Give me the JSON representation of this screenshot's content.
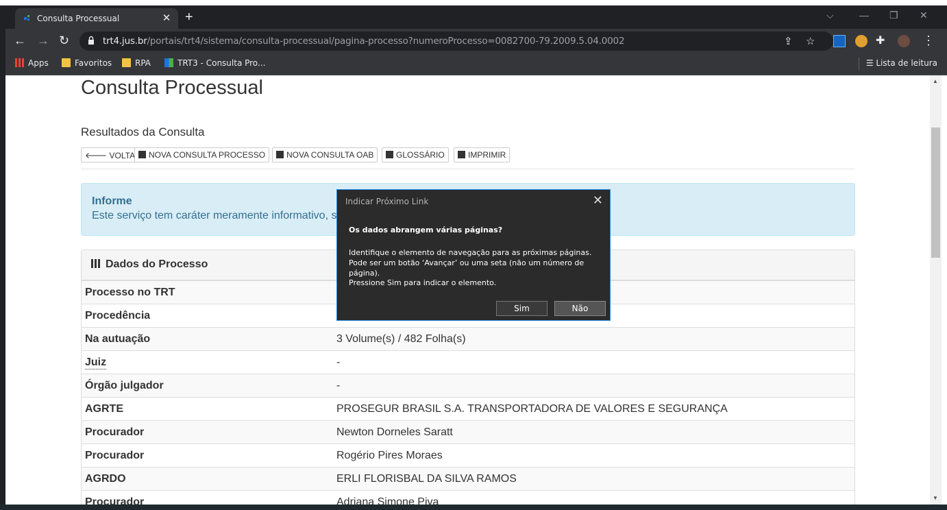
{
  "browser": {
    "tab_title": "Consulta Processual",
    "url_host": "trt4.jus.br",
    "url_path": "/portais/trt4/sistema/consulta-processual/pagina-processo?numeroProcesso=0082700-79.2009.5.04.0002",
    "bookmarks": [
      "Apps",
      "Favoritos",
      "RPA",
      "TRT3 - Consulta Pro..."
    ],
    "reading_list": "Lista de leitura"
  },
  "page": {
    "title": "Consulta Processual",
    "subtitle": "Resultados da Consulta",
    "buttons": [
      "VOLTAR",
      "NOVA CONSULTA PROCESSO",
      "NOVA CONSULTA OAB",
      "GLOSSÁRIO",
      "IMPRIMIR"
    ],
    "alert_title": "Informe",
    "alert_text": "Este serviço tem caráter meramente informativo, s",
    "panel_title": "Dados do Processo",
    "rows": [
      {
        "k": "Processo no TRT",
        "v": ""
      },
      {
        "k": "Procedência",
        "v": ""
      },
      {
        "k": "Na autuação",
        "v": "3 Volume(s) / 482 Folha(s)"
      },
      {
        "k": "Juiz",
        "v": "-"
      },
      {
        "k": "Órgão julgador",
        "v": "-"
      },
      {
        "k": "AGRTE",
        "v": "PROSEGUR BRASIL S.A. TRANSPORTADORA DE VALORES E SEGURANÇA"
      },
      {
        "k": "Procurador",
        "v": "Newton Dorneles Saratt"
      },
      {
        "k": "Procurador",
        "v": "Rogério Pires Moraes"
      },
      {
        "k": "AGRDO",
        "v": "ERLI FLORISBAL DA SILVA RAMOS"
      },
      {
        "k": "Procurador",
        "v": "Adriana Simone Piva"
      }
    ]
  },
  "dialog": {
    "title": "Indicar Próximo Link",
    "question": "Os dados abrangem várias páginas?",
    "body": "Identifique o elemento de navegação para as próximas páginas. Pode ser um botão ‘Avançar’ ou uma seta (não um número de página).",
    "body2": "Pressione Sim para indicar o elemento.",
    "yes": "Sim",
    "no": "Não"
  }
}
